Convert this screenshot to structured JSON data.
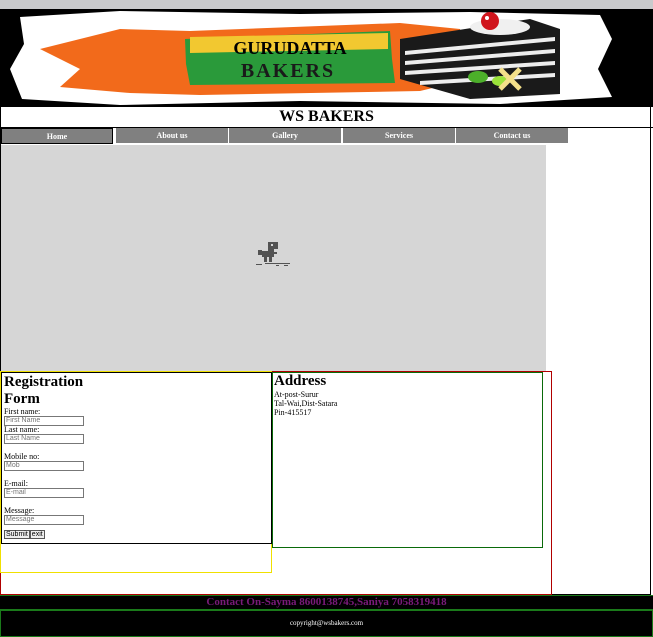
{
  "banner": {
    "line1": "GURUDATTA",
    "line2": "BAKERS"
  },
  "site": {
    "title": "WS BAKERS"
  },
  "nav": {
    "items": [
      {
        "label": "Home"
      },
      {
        "label": "About us"
      },
      {
        "label": "Gallery"
      },
      {
        "label": "Services"
      },
      {
        "label": "Contact us"
      }
    ]
  },
  "media": {
    "icon": "dino-offline-icon"
  },
  "registration": {
    "title_line1": "Registration",
    "title_line2": "Form",
    "first_name_label": "First name:",
    "first_name_placeholder": "First Name",
    "last_name_label": "Last name:",
    "last_name_placeholder": "Last Name",
    "mobile_label": "Mobile no:",
    "mobile_placeholder": "Mob",
    "email_label": "E-mail:",
    "email_placeholder": "E-mail",
    "message_label": "Message:",
    "message_placeholder": "Message",
    "submit_label": "Submit",
    "exit_label": "exit"
  },
  "address": {
    "title": "Address",
    "line1": "At-post-Surur",
    "line2": "Tal-Wai,Dist-Satara",
    "line3": "Pin-415517"
  },
  "contact": {
    "text": "Contact On-Sayma 8600138745,Saniya 7058319418"
  },
  "footer": {
    "text": "copyright@wsbakers.com"
  },
  "colors": {
    "nav_bg": "#808080",
    "contact_text": "#7a1a7a",
    "banner_orange": "#f26a1b",
    "banner_green": "#2a9a3a"
  }
}
